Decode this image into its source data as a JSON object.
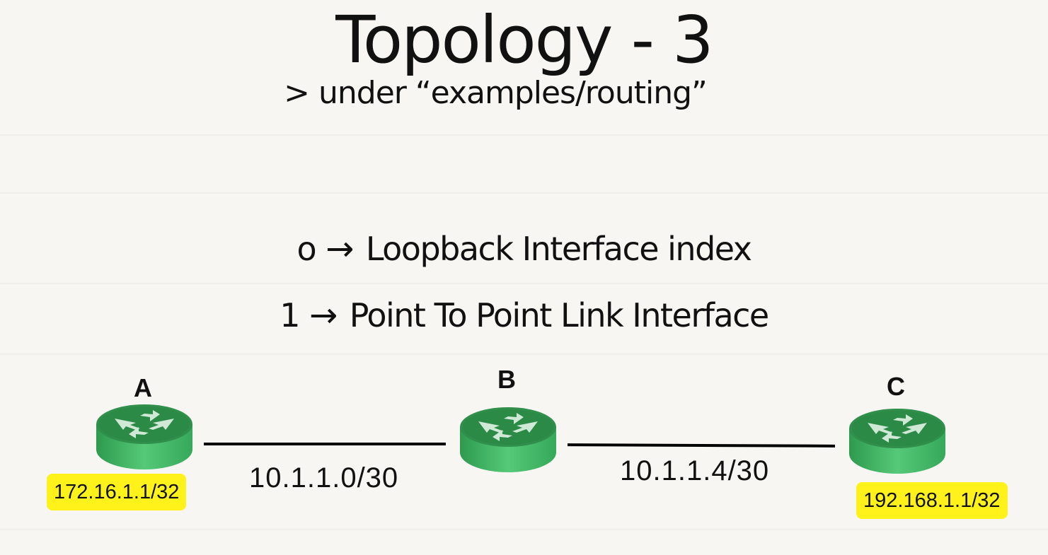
{
  "header": {
    "title": "Topology - 3",
    "subtitle": "> under “examples/routing”"
  },
  "legend": [
    {
      "key": "o",
      "arrow": "→",
      "text": "Loopback Interface index"
    },
    {
      "key": "1",
      "arrow": "→",
      "text": "Point To Point Link Interface"
    }
  ],
  "nodes": [
    {
      "id": "A",
      "label": "A",
      "address": "172.16.1.1/32"
    },
    {
      "id": "B",
      "label": "B",
      "address": ""
    },
    {
      "id": "C",
      "label": "C",
      "address": "192.168.1.1/32"
    }
  ],
  "links": [
    {
      "from": "A",
      "to": "B",
      "subnet": "10.1.1.0/30"
    },
    {
      "from": "B",
      "to": "C",
      "subnet": "10.1.1.4/30"
    }
  ],
  "colors": {
    "router_top": "#2f9c52",
    "router_side": "#45c06a",
    "highlight": "#fff21a",
    "line": "#000000"
  },
  "icons": {
    "router": "router-icon"
  }
}
